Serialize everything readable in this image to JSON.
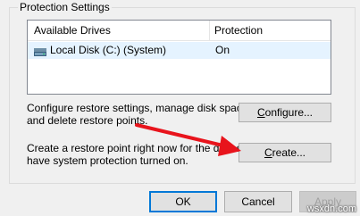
{
  "protection_settings": {
    "title": "Protection Settings",
    "columns": {
      "drives": "Available Drives",
      "protection": "Protection"
    },
    "drives": [
      {
        "name": "Local Disk (C:) (System)",
        "protection": "On",
        "icon": "disk-icon"
      }
    ]
  },
  "configure": {
    "description_line1": "Configure restore settings, manage disk space,",
    "description_line2": "and delete restore points.",
    "button_label_underlined": "C",
    "button_label_rest": "onfigure..."
  },
  "create": {
    "description_line1": "Create a restore point right now for the drives",
    "description_line2": "have system protection turned on.",
    "button_label_underlined": "C",
    "button_label_rest": "reate..."
  },
  "footer": {
    "ok_label": "OK",
    "cancel_label": "Cancel",
    "apply_label_underlined": "A",
    "apply_label_rest": "pply"
  },
  "annotation": {
    "arrow_color": "#e8141c"
  },
  "watermark": "wsxdn.com"
}
